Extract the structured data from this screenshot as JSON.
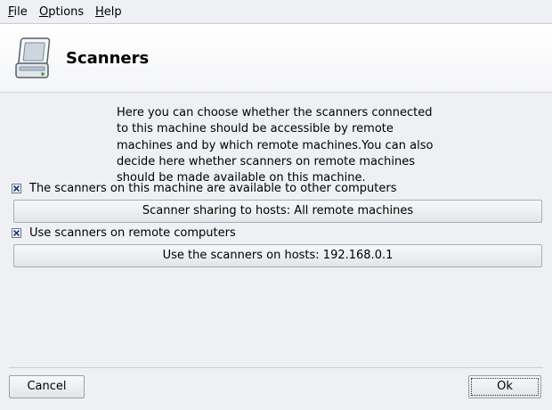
{
  "menu": {
    "file": {
      "u": "F",
      "rest": "ile"
    },
    "options": {
      "u": "O",
      "rest": "ptions"
    },
    "help": {
      "u": "H",
      "rest": "elp"
    }
  },
  "header": {
    "title": "Scanners",
    "icon": "scanner-icon"
  },
  "description": "Here you can choose whether the scanners connected\nto this machine should be accessible by remote\nmachines and by which remote machines.You can also\ndecide here whether scanners on remote machines\nshould be made available on this machine.",
  "options": {
    "share_local": {
      "label": "The scanners on this machine are available to other computers",
      "checked": true
    },
    "share_button": "Scanner sharing to hosts: All remote machines",
    "use_remote": {
      "label": "Use scanners on remote computers",
      "checked": true
    },
    "remote_button": "Use the scanners on hosts: 192.168.0.1"
  },
  "footer": {
    "cancel": "Cancel",
    "ok": "Ok"
  },
  "colors": {
    "background": "#eef0f3",
    "checkmark": "#1b3a8c"
  }
}
